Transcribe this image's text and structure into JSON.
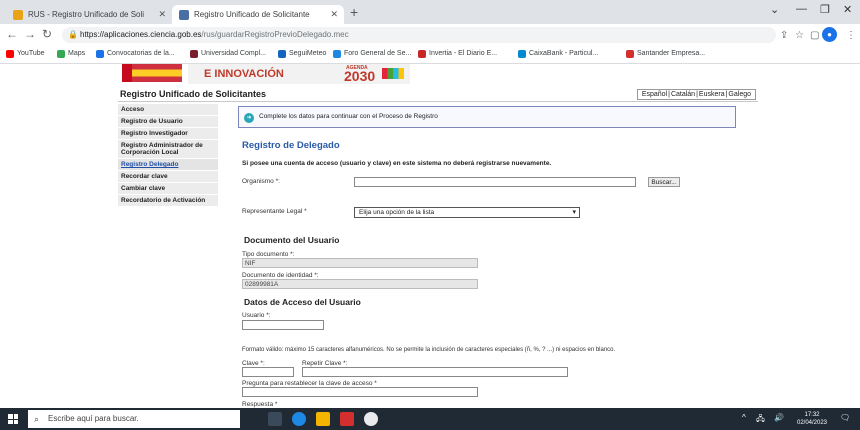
{
  "browser": {
    "tabs": [
      {
        "title": "RUS - Registro Unificado de Soli",
        "active": false
      },
      {
        "title": "Registro Unificado de Solicitante",
        "active": true
      }
    ],
    "url_host": "https://aplicaciones.ciencia.gob.es",
    "url_path": "/rus/guardarRegistroPrevioDelegado.mec",
    "bookmarks": [
      {
        "label": "YouTube",
        "color": "#ff0000"
      },
      {
        "label": "Maps",
        "color": "#34a853"
      },
      {
        "label": "Convocatorias de la...",
        "color": "#1a73e8"
      },
      {
        "label": "Universidad Compl...",
        "color": "#7a1f2b"
      },
      {
        "label": "SeguiMeteo",
        "color": "#1565c0"
      },
      {
        "label": "Foro General de Se...",
        "color": "#1e88e5"
      },
      {
        "label": "Invertia - El Diario E...",
        "color": "#c62828"
      },
      {
        "label": "CaixaBank - Particul...",
        "color": "#0288d1"
      },
      {
        "label": "Santander Empresa...",
        "color": "#d32f2f"
      }
    ],
    "profile_initial": "●"
  },
  "site": {
    "banner_ministry": "E INNOVACIÓN",
    "agenda_label": "AGENDA",
    "agenda_year": "2030",
    "title": "Registro Unificado de Solicitantes",
    "languages": [
      "Español",
      "Catalán",
      "Euskera",
      "Galego"
    ]
  },
  "sidebar": [
    {
      "label": "Acceso",
      "link": false
    },
    {
      "label": "Registro de Usuario",
      "link": false
    },
    {
      "label": "Registro Investigador",
      "link": false
    },
    {
      "label": "Registro Administrador de Corporación Local",
      "link": false
    },
    {
      "label": "Registro Delegado",
      "link": true
    },
    {
      "label": "Recordar clave",
      "link": false
    },
    {
      "label": "Cambiar clave",
      "link": false
    },
    {
      "label": "Recordatorio de Activación",
      "link": false
    }
  ],
  "main": {
    "notice": "Complete los datos para continuar con el Proceso de Registro",
    "heading": "Registro de Delegado",
    "intro": "Si posee una cuenta de acceso (usuario y clave) en este sistema no deberá registrarse nuevamente.",
    "organismo_label": "Organismo *:",
    "buscar_label": "Buscar...",
    "representante_label": "Representante Legal *",
    "representante_value": "Elija una opción de la lista",
    "doc_section": "Documento del Usuario",
    "tipo_doc_label": "Tipo documento *:",
    "tipo_doc_value": "NIF",
    "doc_id_label": "Documento de identidad *:",
    "doc_id_value": "02899981A",
    "access_section": "Datos de Acceso del Usuario",
    "usuario_label": "Usuario *:",
    "format_help": "Formato válido: máximo 15 caracteres alfanuméricos. No se permite la inclusión de caracteres especiales (ñ, %, ? ...) ni espacios en blanco.",
    "clave_label": "Clave *:",
    "repetir_label": "Repetir Clave *:",
    "pregunta_label": "Pregunta para restablecer la clave de acceso *",
    "respuesta_label": "Respuesta *"
  },
  "taskbar": {
    "search_placeholder": "Escribe aquí para buscar.",
    "time": "17:32",
    "date": "02/04/2023"
  }
}
